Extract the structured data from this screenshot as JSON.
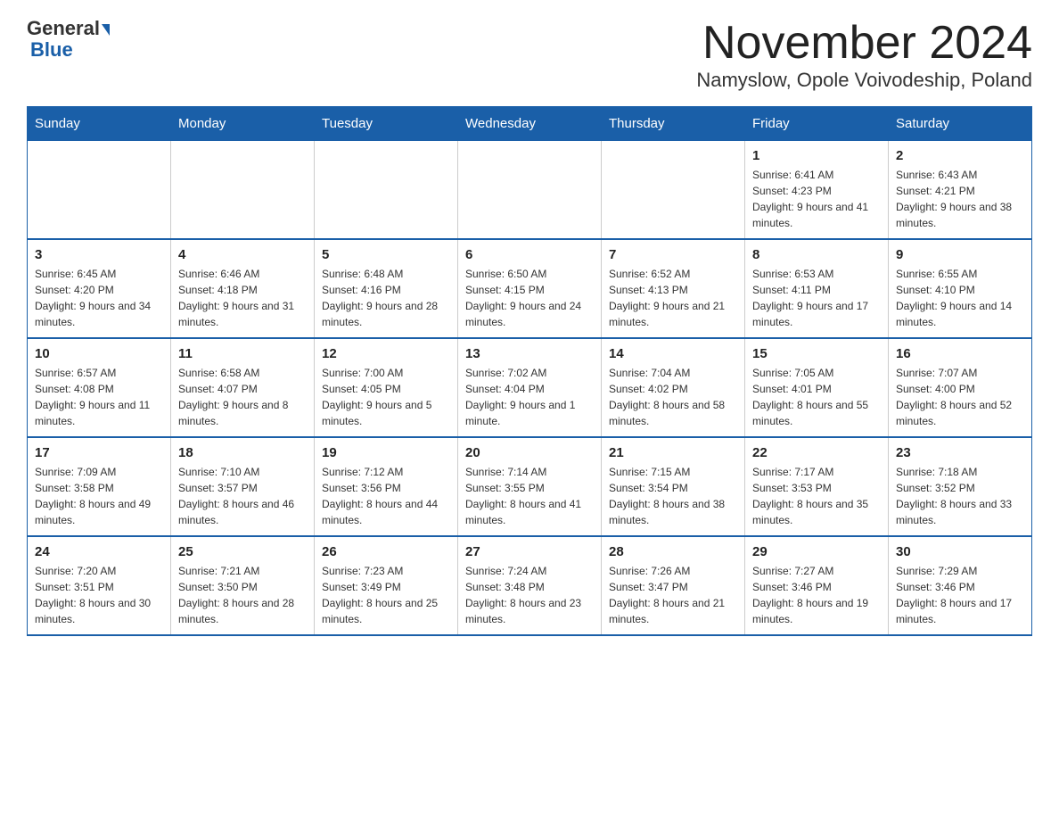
{
  "header": {
    "logo_general": "General",
    "logo_blue": "Blue",
    "month_title": "November 2024",
    "location": "Namyslow, Opole Voivodeship, Poland"
  },
  "weekdays": [
    "Sunday",
    "Monday",
    "Tuesday",
    "Wednesday",
    "Thursday",
    "Friday",
    "Saturday"
  ],
  "weeks": [
    {
      "days": [
        {
          "num": "",
          "info": ""
        },
        {
          "num": "",
          "info": ""
        },
        {
          "num": "",
          "info": ""
        },
        {
          "num": "",
          "info": ""
        },
        {
          "num": "",
          "info": ""
        },
        {
          "num": "1",
          "info": "Sunrise: 6:41 AM\nSunset: 4:23 PM\nDaylight: 9 hours and 41 minutes."
        },
        {
          "num": "2",
          "info": "Sunrise: 6:43 AM\nSunset: 4:21 PM\nDaylight: 9 hours and 38 minutes."
        }
      ]
    },
    {
      "days": [
        {
          "num": "3",
          "info": "Sunrise: 6:45 AM\nSunset: 4:20 PM\nDaylight: 9 hours and 34 minutes."
        },
        {
          "num": "4",
          "info": "Sunrise: 6:46 AM\nSunset: 4:18 PM\nDaylight: 9 hours and 31 minutes."
        },
        {
          "num": "5",
          "info": "Sunrise: 6:48 AM\nSunset: 4:16 PM\nDaylight: 9 hours and 28 minutes."
        },
        {
          "num": "6",
          "info": "Sunrise: 6:50 AM\nSunset: 4:15 PM\nDaylight: 9 hours and 24 minutes."
        },
        {
          "num": "7",
          "info": "Sunrise: 6:52 AM\nSunset: 4:13 PM\nDaylight: 9 hours and 21 minutes."
        },
        {
          "num": "8",
          "info": "Sunrise: 6:53 AM\nSunset: 4:11 PM\nDaylight: 9 hours and 17 minutes."
        },
        {
          "num": "9",
          "info": "Sunrise: 6:55 AM\nSunset: 4:10 PM\nDaylight: 9 hours and 14 minutes."
        }
      ]
    },
    {
      "days": [
        {
          "num": "10",
          "info": "Sunrise: 6:57 AM\nSunset: 4:08 PM\nDaylight: 9 hours and 11 minutes."
        },
        {
          "num": "11",
          "info": "Sunrise: 6:58 AM\nSunset: 4:07 PM\nDaylight: 9 hours and 8 minutes."
        },
        {
          "num": "12",
          "info": "Sunrise: 7:00 AM\nSunset: 4:05 PM\nDaylight: 9 hours and 5 minutes."
        },
        {
          "num": "13",
          "info": "Sunrise: 7:02 AM\nSunset: 4:04 PM\nDaylight: 9 hours and 1 minute."
        },
        {
          "num": "14",
          "info": "Sunrise: 7:04 AM\nSunset: 4:02 PM\nDaylight: 8 hours and 58 minutes."
        },
        {
          "num": "15",
          "info": "Sunrise: 7:05 AM\nSunset: 4:01 PM\nDaylight: 8 hours and 55 minutes."
        },
        {
          "num": "16",
          "info": "Sunrise: 7:07 AM\nSunset: 4:00 PM\nDaylight: 8 hours and 52 minutes."
        }
      ]
    },
    {
      "days": [
        {
          "num": "17",
          "info": "Sunrise: 7:09 AM\nSunset: 3:58 PM\nDaylight: 8 hours and 49 minutes."
        },
        {
          "num": "18",
          "info": "Sunrise: 7:10 AM\nSunset: 3:57 PM\nDaylight: 8 hours and 46 minutes."
        },
        {
          "num": "19",
          "info": "Sunrise: 7:12 AM\nSunset: 3:56 PM\nDaylight: 8 hours and 44 minutes."
        },
        {
          "num": "20",
          "info": "Sunrise: 7:14 AM\nSunset: 3:55 PM\nDaylight: 8 hours and 41 minutes."
        },
        {
          "num": "21",
          "info": "Sunrise: 7:15 AM\nSunset: 3:54 PM\nDaylight: 8 hours and 38 minutes."
        },
        {
          "num": "22",
          "info": "Sunrise: 7:17 AM\nSunset: 3:53 PM\nDaylight: 8 hours and 35 minutes."
        },
        {
          "num": "23",
          "info": "Sunrise: 7:18 AM\nSunset: 3:52 PM\nDaylight: 8 hours and 33 minutes."
        }
      ]
    },
    {
      "days": [
        {
          "num": "24",
          "info": "Sunrise: 7:20 AM\nSunset: 3:51 PM\nDaylight: 8 hours and 30 minutes."
        },
        {
          "num": "25",
          "info": "Sunrise: 7:21 AM\nSunset: 3:50 PM\nDaylight: 8 hours and 28 minutes."
        },
        {
          "num": "26",
          "info": "Sunrise: 7:23 AM\nSunset: 3:49 PM\nDaylight: 8 hours and 25 minutes."
        },
        {
          "num": "27",
          "info": "Sunrise: 7:24 AM\nSunset: 3:48 PM\nDaylight: 8 hours and 23 minutes."
        },
        {
          "num": "28",
          "info": "Sunrise: 7:26 AM\nSunset: 3:47 PM\nDaylight: 8 hours and 21 minutes."
        },
        {
          "num": "29",
          "info": "Sunrise: 7:27 AM\nSunset: 3:46 PM\nDaylight: 8 hours and 19 minutes."
        },
        {
          "num": "30",
          "info": "Sunrise: 7:29 AM\nSunset: 3:46 PM\nDaylight: 8 hours and 17 minutes."
        }
      ]
    }
  ]
}
